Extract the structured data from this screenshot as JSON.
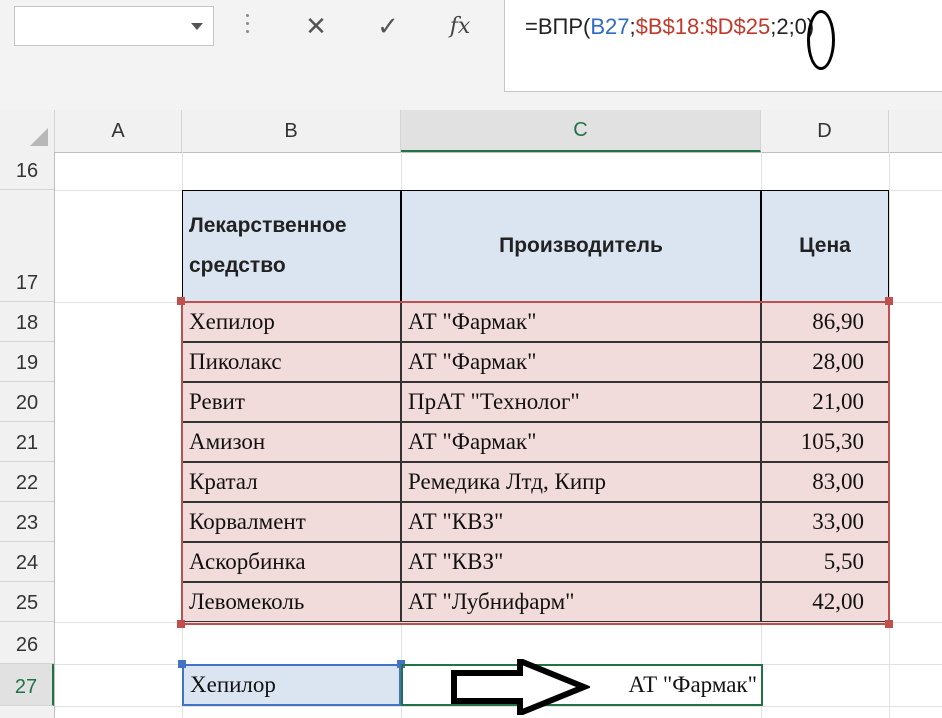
{
  "formula_bar": {
    "name_box": "",
    "cancel_icon": "✕",
    "enter_icon": "✓",
    "fx_label": "fx",
    "formula_prefix": "=ВПР(",
    "formula_ref1": "B27",
    "formula_sep1": ";",
    "formula_ref2": "$B$18:$D$25",
    "formula_sep2": ";",
    "formula_col": "2",
    "formula_tail": ";0)"
  },
  "columns": [
    "A",
    "B",
    "C",
    "D"
  ],
  "rows": [
    "16",
    "17",
    "18",
    "19",
    "20",
    "21",
    "22",
    "23",
    "24",
    "25",
    "26",
    "27"
  ],
  "table": {
    "header": {
      "name": "Лекарственное средство",
      "maker": "Производитель",
      "price": "Цена"
    },
    "rows": [
      {
        "name": "Хепилор",
        "maker": "АТ \"Фармак\"",
        "price": "86,90"
      },
      {
        "name": "Пиколакс",
        "maker": "АТ \"Фармак\"",
        "price": "28,00"
      },
      {
        "name": "Ревит",
        "maker": "ПрАТ \"Технолог\"",
        "price": "21,00"
      },
      {
        "name": "Амизон",
        "maker": "АТ \"Фармак\"",
        "price": "105,30"
      },
      {
        "name": "Кратал",
        "maker": "Ремедика Лтд, Кипр",
        "price": "83,00"
      },
      {
        "name": "Корвалмент",
        "maker": "АТ \"КВЗ\"",
        "price": "33,00"
      },
      {
        "name": "Аскорбинка",
        "maker": "АТ \"КВЗ\"",
        "price": "5,50"
      },
      {
        "name": "Левомеколь",
        "maker": "АТ \"Лубнифарм\"",
        "price": "42,00"
      }
    ]
  },
  "lookup": {
    "input": "Хепилор",
    "result": "АТ \"Фармак\""
  },
  "colors": {
    "header_fill": "#dbe5f1",
    "row_fill": "#f2dcdb",
    "range_border": "#c0504d",
    "ref_blue": "#2f6bc4",
    "ref_red": "#c0392b",
    "excel_green": "#217346"
  }
}
